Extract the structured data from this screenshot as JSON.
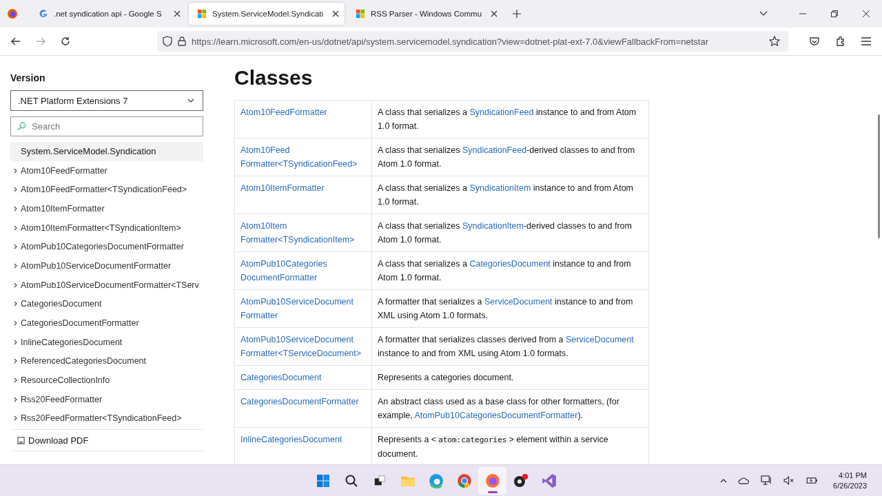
{
  "browser": {
    "tabs": [
      {
        "title": ".net syndication api - Google S",
        "selected": false
      },
      {
        "title": "System.ServiceModel.Syndicati",
        "selected": true
      },
      {
        "title": "RSS Parser - Windows Commu",
        "selected": false
      }
    ],
    "url": "https://learn.microsoft.com/en-us/dotnet/api/system.servicemodel.syndication?view=dotnet-plat-ext-7.0&viewFallbackFrom=netstar"
  },
  "sidebar": {
    "version_label": "Version",
    "version_value": ".NET Platform Extensions 7",
    "search_placeholder": "Search",
    "items": [
      {
        "label": "System.ServiceModel.Syndication",
        "kind": "root",
        "selected": true
      },
      {
        "label": "Atom10FeedFormatter",
        "kind": "node",
        "selected": false
      },
      {
        "label": "Atom10FeedFormatter<TSyndicationFeed>",
        "kind": "node",
        "selected": false
      },
      {
        "label": "Atom10ItemFormatter",
        "kind": "node",
        "selected": false
      },
      {
        "label": "Atom10ItemFormatter<TSyndicationItem>",
        "kind": "node",
        "selected": false
      },
      {
        "label": "AtomPub10CategoriesDocumentFormatter",
        "kind": "node",
        "selected": false
      },
      {
        "label": "AtomPub10ServiceDocumentFormatter",
        "kind": "node",
        "selected": false
      },
      {
        "label": "AtomPub10ServiceDocumentFormatter<TServ",
        "kind": "node",
        "selected": false
      },
      {
        "label": "CategoriesDocument",
        "kind": "node",
        "selected": false
      },
      {
        "label": "CategoriesDocumentFormatter",
        "kind": "node",
        "selected": false
      },
      {
        "label": "InlineCategoriesDocument",
        "kind": "node",
        "selected": false
      },
      {
        "label": "ReferencedCategoriesDocument",
        "kind": "node",
        "selected": false
      },
      {
        "label": "ResourceCollectionInfo",
        "kind": "node",
        "selected": false
      },
      {
        "label": "Rss20FeedFormatter",
        "kind": "node",
        "selected": false
      },
      {
        "label": "Rss20FeedFormatter<TSyndicationFeed>",
        "kind": "node",
        "selected": false
      }
    ],
    "download": "Download PDF"
  },
  "main": {
    "heading": "Classes",
    "rows": [
      {
        "name": [
          "Atom10FeedFormatter"
        ],
        "description": [
          {
            "kind": "text",
            "text": "A class that serializes a "
          },
          {
            "kind": "link",
            "text": "SyndicationFeed"
          },
          {
            "kind": "text",
            "text": " instance to and from Atom 1.0 format."
          }
        ]
      },
      {
        "name": [
          "Atom10Feed",
          "Formatter<TSyndicationFeed>"
        ],
        "description": [
          {
            "kind": "text",
            "text": "A class that serializes "
          },
          {
            "kind": "link",
            "text": "SyndicationFeed"
          },
          {
            "kind": "text",
            "text": "-derived classes to and from Atom 1.0 format."
          }
        ]
      },
      {
        "name": [
          "Atom10ItemFormatter"
        ],
        "description": [
          {
            "kind": "text",
            "text": "A class that serializes a "
          },
          {
            "kind": "link",
            "text": "SyndicationItem"
          },
          {
            "kind": "text",
            "text": " instance to and from Atom 1.0 format."
          }
        ]
      },
      {
        "name": [
          "Atom10Item",
          "Formatter<TSyndicationItem>"
        ],
        "description": [
          {
            "kind": "text",
            "text": "A class that serializes "
          },
          {
            "kind": "link",
            "text": "SyndicationItem"
          },
          {
            "kind": "text",
            "text": "-derived classes to and from Atom 1.0 format."
          }
        ]
      },
      {
        "name": [
          "AtomPub10Categories",
          "DocumentFormatter"
        ],
        "description": [
          {
            "kind": "text",
            "text": "A class that serializes a "
          },
          {
            "kind": "link",
            "text": "CategoriesDocument"
          },
          {
            "kind": "text",
            "text": " instance to and from Atom 1.0 format."
          }
        ]
      },
      {
        "name": [
          "AtomPub10ServiceDocument",
          "Formatter"
        ],
        "description": [
          {
            "kind": "text",
            "text": "A formatter that serializes a "
          },
          {
            "kind": "link",
            "text": "ServiceDocument"
          },
          {
            "kind": "text",
            "text": " instance to and from XML using Atom 1.0 formats."
          }
        ]
      },
      {
        "name": [
          "AtomPub10ServiceDocument",
          "Formatter<TServiceDocument>"
        ],
        "description": [
          {
            "kind": "text",
            "text": "A formatter that serializes classes derived from a "
          },
          {
            "kind": "link",
            "text": "ServiceDocument"
          },
          {
            "kind": "text",
            "text": " instance to and from XML using Atom 1.0 formats."
          }
        ]
      },
      {
        "name": [
          "CategoriesDocument"
        ],
        "description": [
          {
            "kind": "text",
            "text": "Represents a categories document."
          }
        ]
      },
      {
        "name": [
          "CategoriesDocumentFormatter"
        ],
        "description": [
          {
            "kind": "text",
            "text": "An abstract class used as a base class for other formatters, (for example, "
          },
          {
            "kind": "link",
            "text": "AtomPub10CategoriesDocumentFormatter"
          },
          {
            "kind": "text",
            "text": ")."
          }
        ]
      },
      {
        "name": [
          "InlineCategoriesDocument"
        ],
        "description": [
          {
            "kind": "text",
            "text": "Represents a <"
          },
          {
            "kind": "code",
            "text": "atom:categories"
          },
          {
            "kind": "text",
            "text": "> element within a service document."
          }
        ]
      }
    ]
  },
  "taskbar": {
    "apps": [
      {
        "active": false
      },
      {
        "active": false
      },
      {
        "active": false
      },
      {
        "active": false
      },
      {
        "active": false
      },
      {
        "active": false
      },
      {
        "active": true
      },
      {
        "active": false
      },
      {
        "active": false
      }
    ],
    "time": "4:01 PM",
    "date": "6/26/2023"
  }
}
